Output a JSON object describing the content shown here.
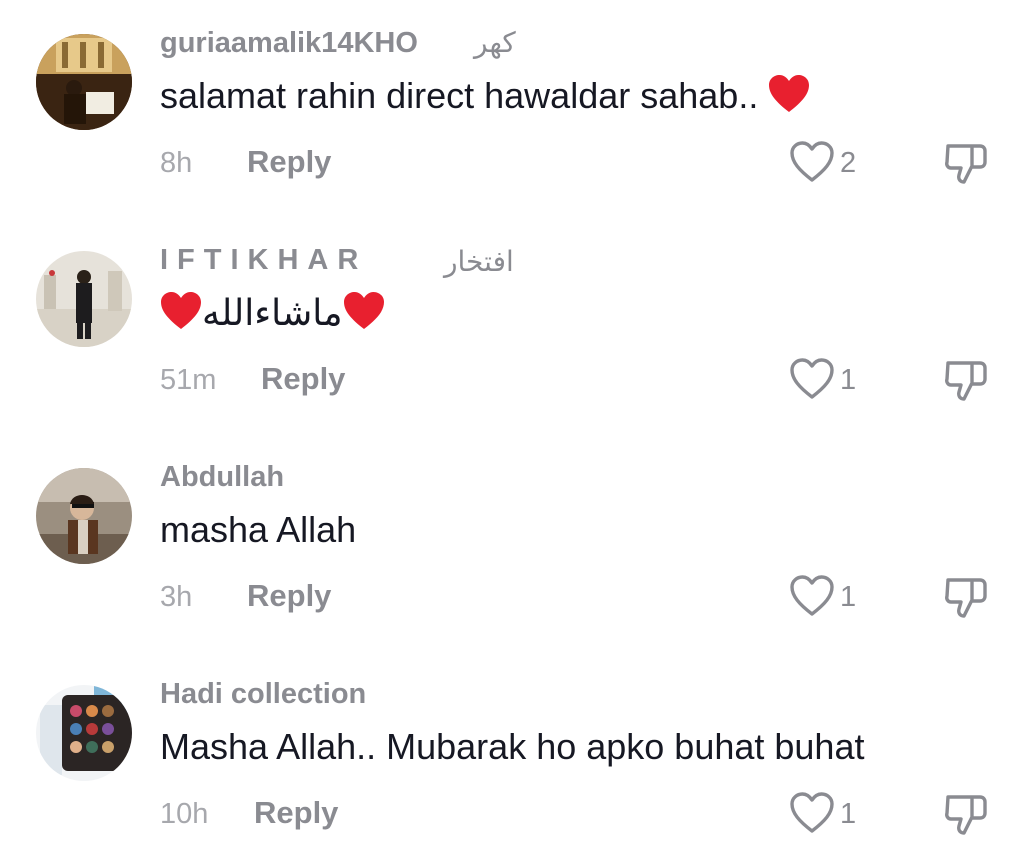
{
  "comments": [
    {
      "username": "guriaamalik14KHO",
      "nickname_extra": "کھر",
      "text": "salamat rahin direct hawaldar sahab..",
      "time": "8h",
      "reply_label": "Reply",
      "likes": "2"
    },
    {
      "username": "IFTIKHAR",
      "nickname_extra": "افتخار",
      "text": "ماشاءالله",
      "time": "51m",
      "reply_label": "Reply",
      "likes": "1"
    },
    {
      "username": "Abdullah",
      "text": "masha Allah",
      "time": "3h",
      "reply_label": "Reply",
      "likes": "1"
    },
    {
      "username": "Hadi collection",
      "text": "Masha Allah.. Mubarak ho apko buhat buhat",
      "time": "10h",
      "reply_label": "Reply",
      "likes": "1"
    }
  ],
  "icons": {
    "like": "heart-outline-icon",
    "dislike": "thumbs-down-icon",
    "emoji": "red-heart-emoji"
  },
  "colors": {
    "username": "#8a8b91",
    "text": "#161823",
    "meta": "#a7a8ad",
    "heart_emoji": "#e8202f"
  }
}
